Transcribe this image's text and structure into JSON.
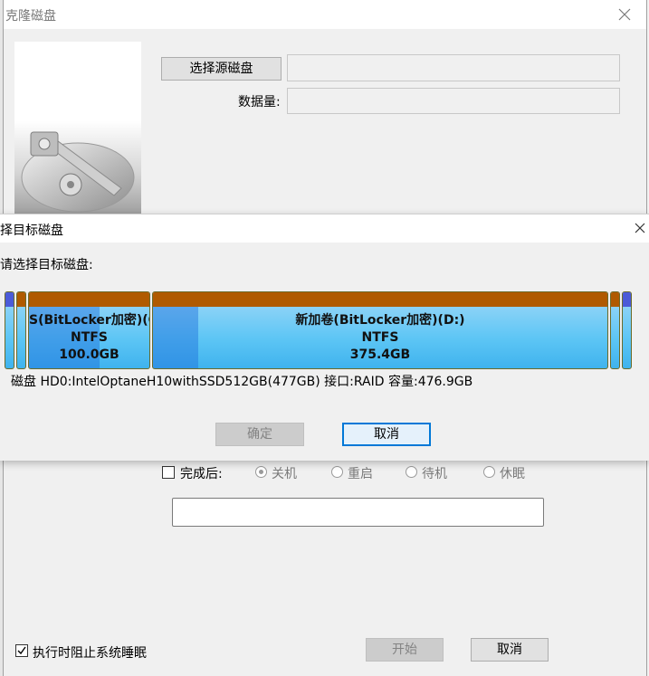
{
  "clone_window": {
    "title": "克隆磁盘",
    "select_source_label": "选择源磁盘",
    "source_value": "",
    "data_amount_label": "数据量:",
    "data_amount_value": ""
  },
  "target_dialog": {
    "title": "择目标磁盘",
    "prompt": "请选择目标磁盘:",
    "partitions": [
      {
        "name": "S(BitLocker加密)(C",
        "fs": "NTFS",
        "size": "100.0GB"
      },
      {
        "name": "新加卷(BitLocker加密)(D:)",
        "fs": "NTFS",
        "size": "375.4GB"
      }
    ],
    "disk_info": "磁盘 HD0:IntelOptaneH10withSSD512GB(477GB)  接口:RAID  容量:476.9GB",
    "ok_label": "确定",
    "cancel_label": "取消"
  },
  "after_complete": {
    "label": "完成后:",
    "checked": false,
    "options": [
      {
        "label": "关机",
        "selected": true
      },
      {
        "label": "重启",
        "selected": false
      },
      {
        "label": "待机",
        "selected": false
      },
      {
        "label": "休眠",
        "selected": false
      }
    ]
  },
  "progress_text": "",
  "prevent_sleep": {
    "label": "执行时阻止系统睡眠",
    "checked": true
  },
  "footer": {
    "start_label": "开始",
    "cancel_label": "取消"
  },
  "colors": {
    "partition_cap": "#b05a00",
    "partition_fill": "#5ec6f5",
    "focus": "#0078d7"
  }
}
